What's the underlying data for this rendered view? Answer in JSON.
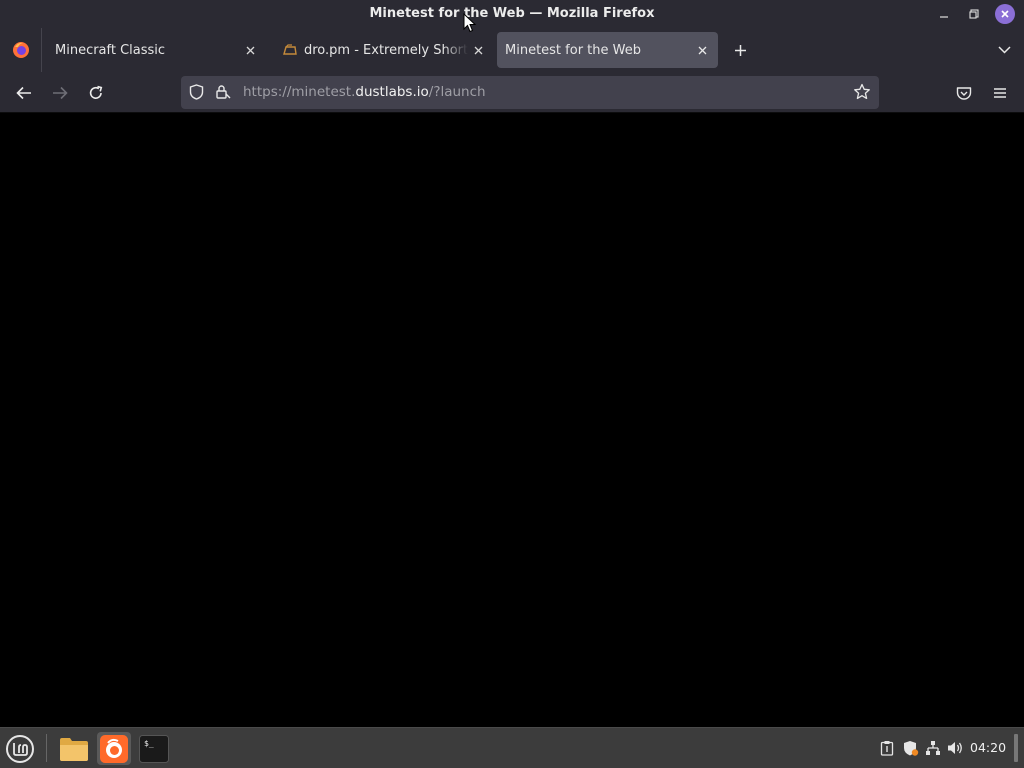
{
  "window": {
    "title": "Minetest for the Web — Mozilla Firefox"
  },
  "tabs": [
    {
      "label": "Minecraft Classic",
      "active": false
    },
    {
      "label": "dro.pm - Extremely Short URLs",
      "active": false
    },
    {
      "label": "Minetest for the Web",
      "active": true
    }
  ],
  "navbar": {
    "url_prefix": "https://minetest.",
    "url_host": "dustlabs.io",
    "url_suffix": "/?launch"
  },
  "taskbar": {
    "clock": "04:20",
    "apps": [
      "files",
      "firefox",
      "terminal"
    ]
  },
  "colors": {
    "chrome": "#2b2a33",
    "active_tab": "#52525e",
    "urlbar": "#42414d",
    "close_button": "#8b6fd6",
    "taskbar": "#3c3c3c"
  },
  "icons": {
    "window_controls": [
      "minimize-icon",
      "maximize-icon",
      "close-icon"
    ],
    "navigation": [
      "back-arrow-icon",
      "forward-arrow-icon",
      "reload-icon",
      "shield-icon",
      "lock-icon",
      "star-icon",
      "pocket-icon",
      "hamburger-icon"
    ],
    "tray": [
      "clipboard-icon",
      "shield-update-icon",
      "network-icon",
      "volume-icon"
    ]
  }
}
